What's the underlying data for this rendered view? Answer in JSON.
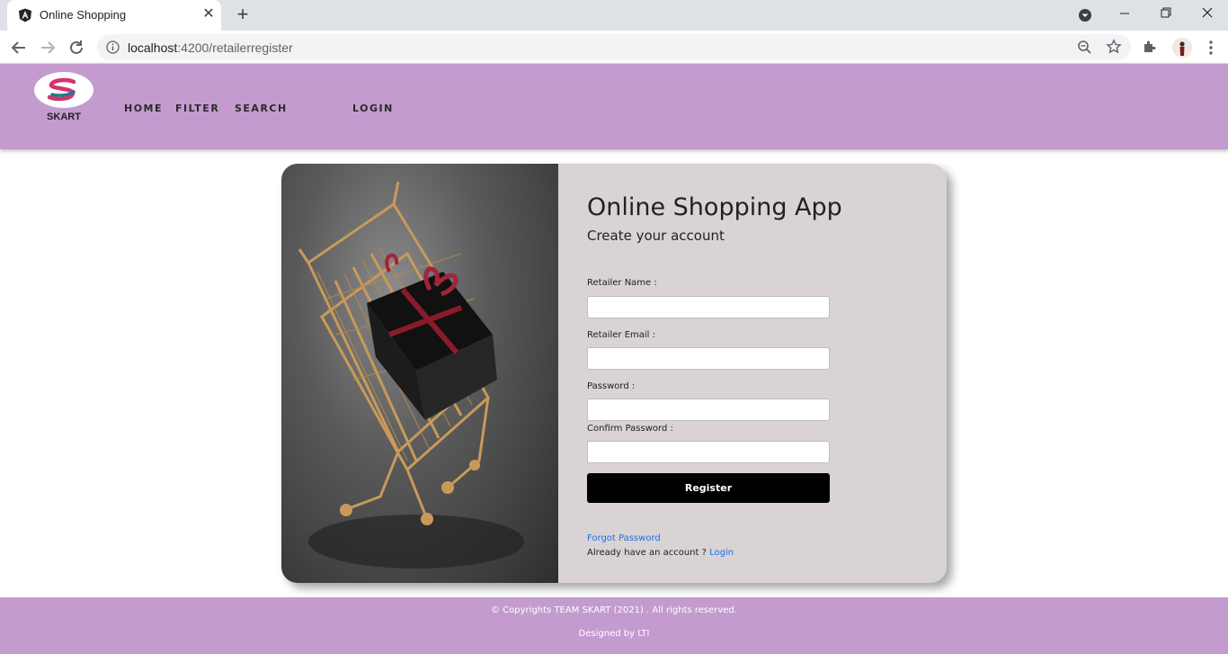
{
  "browser": {
    "tab_title": "Online Shopping",
    "url_host": "localhost",
    "url_path": ":4200/retailerregister"
  },
  "header": {
    "logo_text": "SKART",
    "nav": [
      {
        "label": "HOME"
      },
      {
        "label": "FILTER"
      },
      {
        "label": "SEARCH"
      },
      {
        "label": "LOGIN"
      }
    ],
    "color": "#c49bcf"
  },
  "form": {
    "title": "Online Shopping App",
    "subtitle": "Create your account",
    "fields": [
      {
        "label": "Retailer Name :",
        "value": ""
      },
      {
        "label": "Retailer Email :",
        "value": ""
      },
      {
        "label": "Password :",
        "value": ""
      },
      {
        "label": "Confirm Password :",
        "value": ""
      }
    ],
    "register_label": "Register",
    "forgot_password": "Forgot Password",
    "already_text": "Already have an account ? ",
    "login_link": "Login"
  },
  "footer": {
    "copyright": "© Copyrights TEAM SKART (2021) . All rights reserved.",
    "designed_by": "Designed by LTI"
  }
}
